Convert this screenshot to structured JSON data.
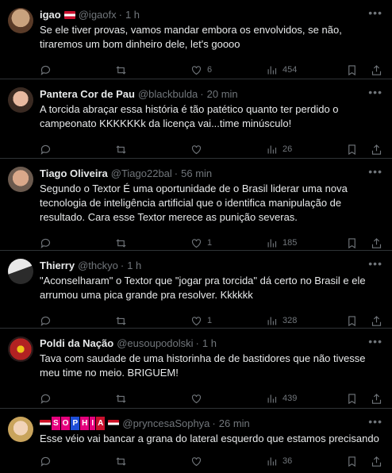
{
  "tweets": [
    {
      "name": "igao",
      "handle": "@igaofx",
      "time": "1 h",
      "text": "Se ele tiver provas, vamos mandar embora os envolvidos, se não, tiraremos um bom dinheiro dele, let's goooo",
      "reply": "",
      "retweet": "",
      "like": "6",
      "views": "454",
      "flag": "red"
    },
    {
      "name": "Pantera Cor de Pau",
      "handle": "@blackbulda",
      "time": "20 min",
      "text": "A torcida abraçar essa história é tão patético quanto ter perdido o campeonato KKKKKKk da licença vai...time minúsculo!",
      "reply": "",
      "retweet": "",
      "like": "",
      "views": "26"
    },
    {
      "name": "Tiago Oliveira",
      "handle": "@Tiago22bal",
      "time": "56 min",
      "text": "Segundo o Textor É uma oportunidade de o Brasil liderar uma nova tecnologia de inteligência artificial que o identifica manipulação de resultado. Cara esse Textor merece as punição severas.",
      "reply": "",
      "retweet": "",
      "like": "1",
      "views": "185"
    },
    {
      "name": "Thierry",
      "handle": "@thckyo",
      "time": "1 h",
      "text": "\"Aconselharam\" o Textor que \"jogar pra torcida\" dá certo no Brasil e ele arrumou uma pica grande pra resolver. Kkkkkk",
      "reply": "",
      "retweet": "",
      "like": "1",
      "views": "328"
    },
    {
      "name": "Poldi da Nação",
      "handle": "@eusoupodolski",
      "time": "1 h",
      "text": "Tava com saudade de uma historinha de de bastidores que não tivesse meu time no meio. BRIGUEM!",
      "reply": "",
      "retweet": "",
      "like": "",
      "views": "439"
    },
    {
      "name_badges": [
        "S",
        "O",
        "P",
        "H",
        "I",
        "A"
      ],
      "handle": "@pryncesaSophya",
      "time": "26 min",
      "text": "Esse véio vai bancar a grana do lateral esquerdo que estamos precisando",
      "views": "36"
    }
  ],
  "colors": {
    "background": "#000000",
    "text": "#e7e9ea",
    "muted": "#71767b",
    "divider": "#2f3336"
  }
}
